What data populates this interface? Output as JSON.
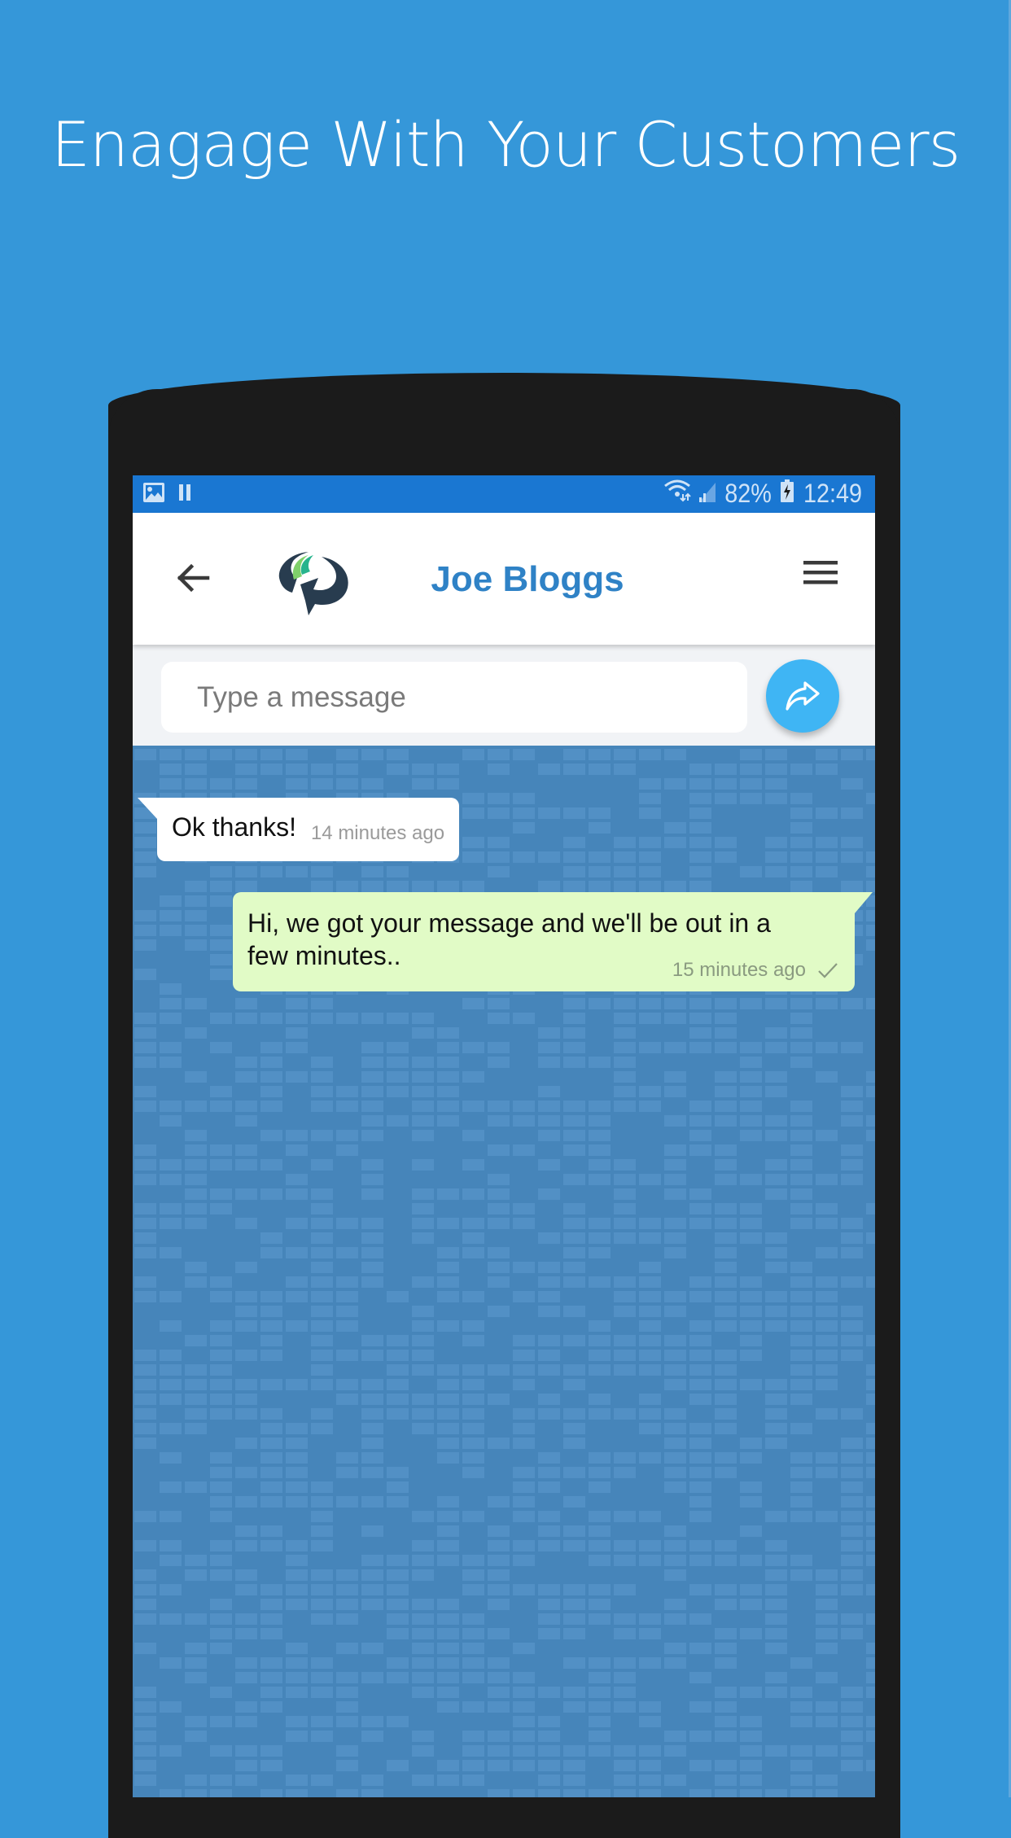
{
  "headline": "Enagage With Your Customers",
  "status_bar": {
    "left_icons": [
      "image-icon",
      "pause-icon"
    ],
    "right_icons": [
      "wifi-icon",
      "signal-icon",
      "battery-charging-icon"
    ],
    "battery": "82%",
    "time": "12:49"
  },
  "app_bar": {
    "back_icon": "arrow-left-icon",
    "logo": "chat-logo",
    "contact_name": "Joe Bloggs",
    "menu_icon": "hamburger-menu-icon"
  },
  "composer": {
    "placeholder": "Type a message",
    "value": "",
    "send_icon": "share-forward-icon"
  },
  "messages": [
    {
      "direction": "incoming",
      "text": "Ok thanks!",
      "time": "14 minutes ago"
    },
    {
      "direction": "outgoing",
      "text": "Hi, we got your message and we'll be out in a few minutes..",
      "time": "15 minutes ago",
      "status_icon": "check-icon"
    }
  ],
  "colors": {
    "page_background": "#3597d9",
    "status_bar": "#1a77d2",
    "accent": "#2f82c6",
    "send_button": "#3fb5f4",
    "chat_background": "#4685ba",
    "outgoing_bubble": "#e1fbc6",
    "incoming_bubble": "#ffffff"
  }
}
